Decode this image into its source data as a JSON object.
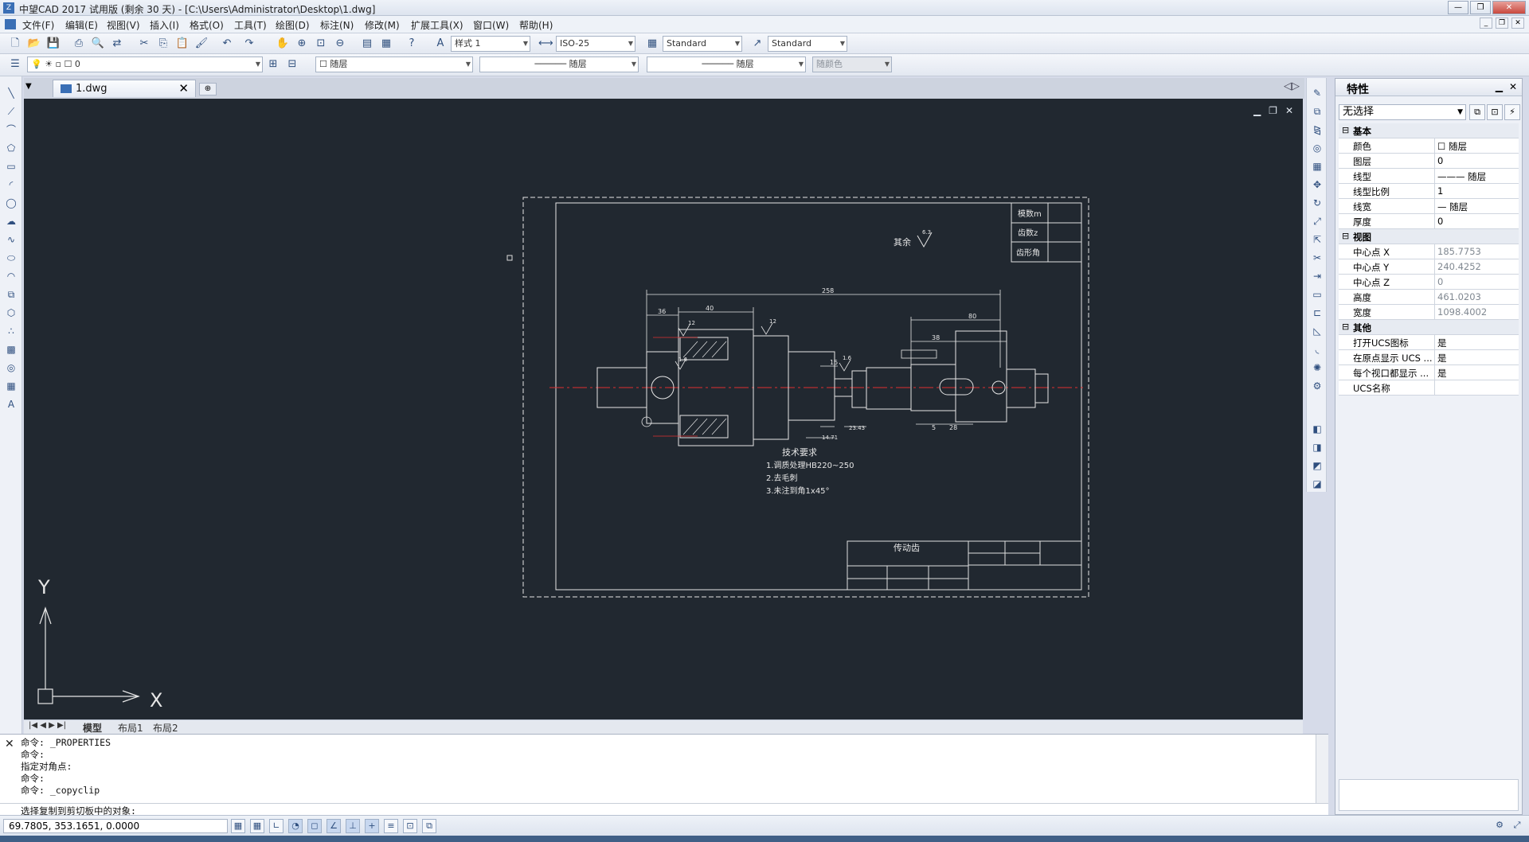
{
  "window": {
    "title": "中望CAD 2017 试用版 (剩余 30 天) - [C:\\Users\\Administrator\\Desktop\\1.dwg]"
  },
  "menu": [
    "文件(F)",
    "编辑(E)",
    "视图(V)",
    "插入(I)",
    "格式(O)",
    "工具(T)",
    "绘图(D)",
    "标注(N)",
    "修改(M)",
    "扩展工具(X)",
    "窗口(W)",
    "帮助(H)"
  ],
  "toolbar": {
    "text_style": "样式 1",
    "dim_style": "ISO-25",
    "table_style": "Standard",
    "mleader_style": "Standard",
    "layer": "0",
    "color": "随层",
    "linetype": "随层",
    "lineweight": "随层",
    "plotstyle": "随颜色"
  },
  "tabs": {
    "document": "1.dwg"
  },
  "layout_tabs": [
    "模型",
    "布局1",
    "布局2"
  ],
  "drawing": {
    "title_block_params": [
      "模数m",
      "齿数z",
      "齿形角"
    ],
    "surface_finish_note": "其余",
    "tech_title": "技术要求",
    "tech_notes": [
      "1.调质处理HB220~250",
      "2.去毛刺",
      "3.未注到角1x45°"
    ],
    "part_name": "传动齿",
    "dims": {
      "overall": "258",
      "d36": "36",
      "d40": "40",
      "d80": "80",
      "d38": "38",
      "d15": "15",
      "d5": "5",
      "d28": "28",
      "d14": "14.71",
      "d23": "23.43"
    },
    "roughness": [
      "6.3",
      "12",
      "1.6",
      "12",
      "1.6"
    ]
  },
  "axis": {
    "x": "X",
    "y": "Y"
  },
  "command": {
    "lines": [
      "命令: _PROPERTIES",
      "命令:",
      "指定对角点:",
      "命令:",
      "命令: _copyclip"
    ],
    "prompt": "选择复制到剪切板中的对象:"
  },
  "status": {
    "coords": "69.7805, 353.1651, 0.0000"
  },
  "properties": {
    "title": "特性",
    "selection": "无选择",
    "sections": [
      {
        "name": "基本",
        "rows": [
          {
            "k": "颜色",
            "v": "☐ 随层",
            "gray": false
          },
          {
            "k": "图层",
            "v": "0",
            "gray": false
          },
          {
            "k": "线型",
            "v": "——— 随层",
            "gray": false
          },
          {
            "k": "线型比例",
            "v": "1",
            "gray": false
          },
          {
            "k": "线宽",
            "v": "— 随层",
            "gray": false
          },
          {
            "k": "厚度",
            "v": "0",
            "gray": false
          }
        ]
      },
      {
        "name": "视图",
        "rows": [
          {
            "k": "中心点 X",
            "v": "185.7753",
            "gray": true
          },
          {
            "k": "中心点 Y",
            "v": "240.4252",
            "gray": true
          },
          {
            "k": "中心点 Z",
            "v": "0",
            "gray": true
          },
          {
            "k": "高度",
            "v": "461.0203",
            "gray": true
          },
          {
            "k": "宽度",
            "v": "1098.4002",
            "gray": true
          }
        ]
      },
      {
        "name": "其他",
        "rows": [
          {
            "k": "打开UCS图标",
            "v": "是",
            "gray": false
          },
          {
            "k": "在原点显示 UCS ...",
            "v": "是",
            "gray": false
          },
          {
            "k": "每个视口都显示 ...",
            "v": "是",
            "gray": false
          },
          {
            "k": "UCS名称",
            "v": "",
            "gray": false
          }
        ]
      }
    ]
  }
}
